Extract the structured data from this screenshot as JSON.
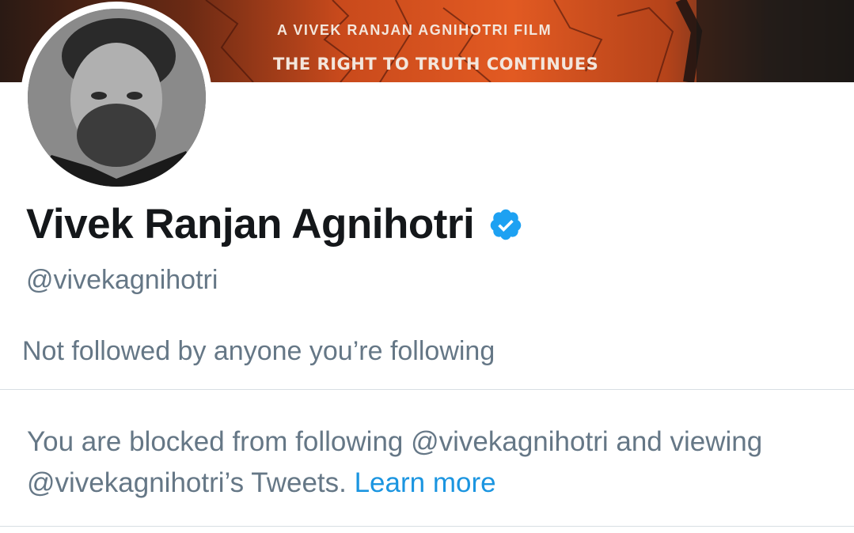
{
  "banner": {
    "line1": "A VIVEK RANJAN AGNIHOTRI FILM",
    "line2": "THE RIGHT TO TRUTH CONTINUES"
  },
  "profile": {
    "display_name": "Vivek Ranjan Agnihotri",
    "verified_icon": "verified-badge-icon",
    "handle": "@vivekagnihotri",
    "followed_by": "Not followed by anyone you’re following"
  },
  "blocked": {
    "message": "You are blocked from following @vivekagnihotri and viewing @vivekagnihotri’s Tweets.",
    "link_label": "Learn more"
  },
  "colors": {
    "primary_text": "#14171a",
    "secondary_text": "#657786",
    "link": "#1b95e0",
    "verified": "#1da1f2",
    "divider": "#d8dee3"
  }
}
